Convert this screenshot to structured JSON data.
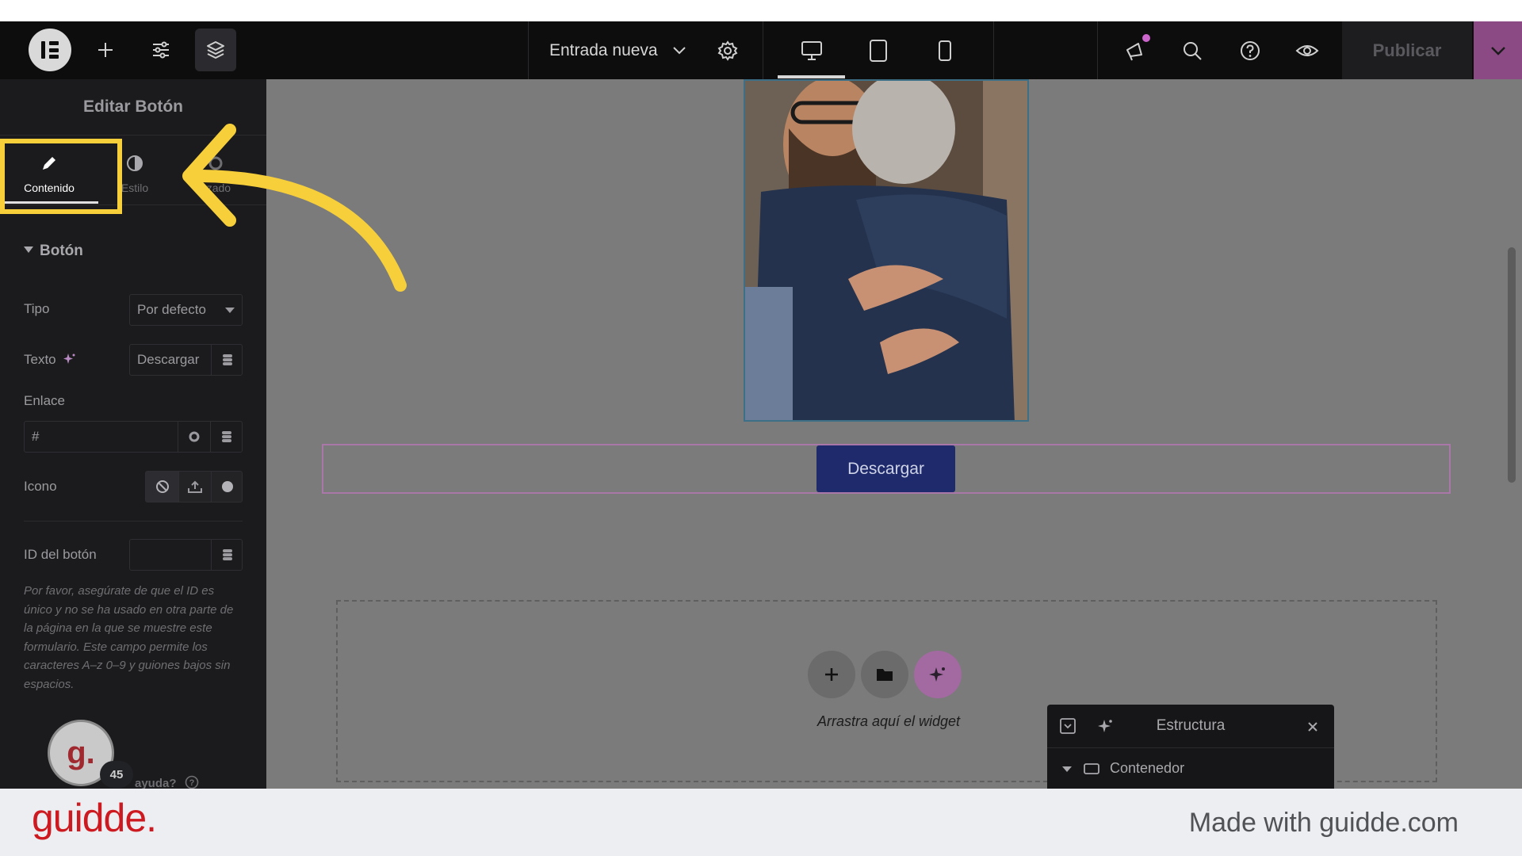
{
  "topbar": {
    "page_title": "Entrada nueva",
    "publish_label": "Publicar",
    "icons": [
      "elementor-logo-icon",
      "add-icon",
      "sliders-icon",
      "layers-icon",
      "chevron-down-icon",
      "gear-icon",
      "desktop-icon",
      "tablet-icon",
      "mobile-icon",
      "megaphone-icon",
      "search-icon",
      "help-icon",
      "eye-icon",
      "chevron-down-icon"
    ]
  },
  "panel": {
    "title": "Editar Botón",
    "tabs": [
      {
        "label": "Contenido",
        "active": true
      },
      {
        "label": "Estilo",
        "active": false
      },
      {
        "label": "Avanzado",
        "active": false
      }
    ],
    "tab_visible": {
      "style": "Estilo",
      "advanced": "nzado"
    },
    "section": "Botón",
    "fields": {
      "type_label": "Tipo",
      "type_value": "Por defecto",
      "text_label": "Texto",
      "text_value": "Descargar",
      "link_label": "Enlace",
      "link_value": "#",
      "icon_label": "Icono",
      "button_id_label": "ID del botón",
      "button_id_value": ""
    },
    "help_text": "Por favor, asegúrate de que el ID es único y no se ha usado en otra parte de la página en la que se muestre este formulario. Este campo permite los caracteres A–z  0–9 y guiones bajos sin espacios.",
    "help_link": "ayuda?",
    "badge_letter": "g.",
    "badge_count": "45"
  },
  "canvas": {
    "button_label": "Descargar",
    "dropzone_text": "Arrastra aquí el widget"
  },
  "structure": {
    "title": "Estructura",
    "item": "Contenedor"
  },
  "footer": {
    "logo": "guidde.",
    "made_with": "Made with guidde.com"
  },
  "colors": {
    "accent_pink": "#8b4a84",
    "highlight_yellow": "#f7cf3b",
    "button_blue": "#1e2a6b",
    "brand_red": "#cd1a20"
  }
}
